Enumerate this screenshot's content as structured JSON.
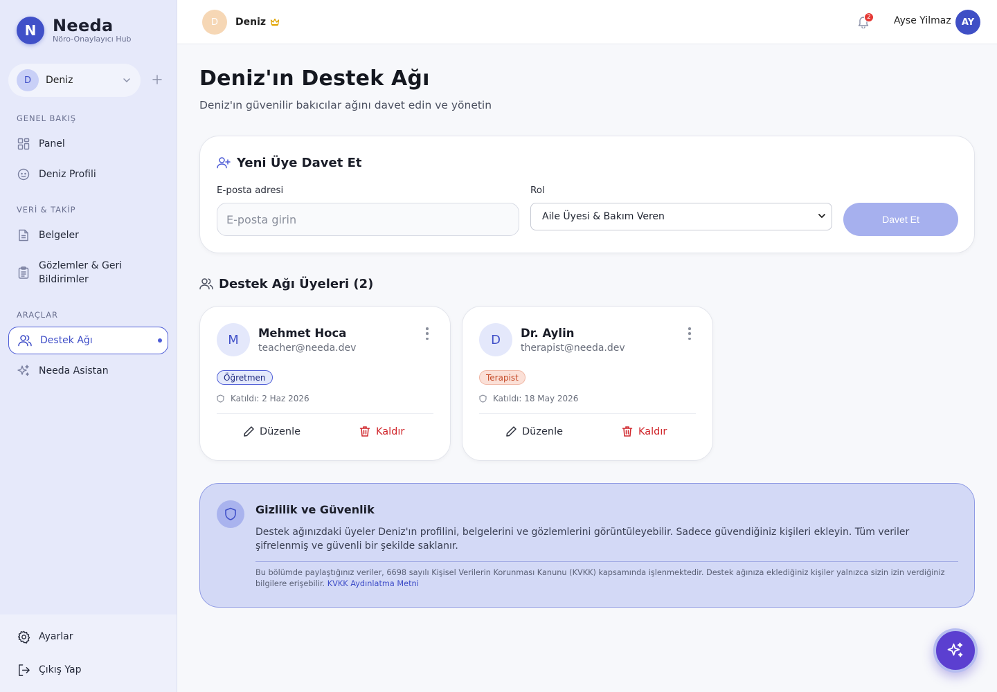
{
  "brand": {
    "logo_letter": "N",
    "name": "Needa",
    "subtitle": "Nöro-Onaylayıcı Hub"
  },
  "child_selector": {
    "avatar_letter": "D",
    "name": "Deniz"
  },
  "sidebar": {
    "sections": [
      {
        "label": "GENEL BAKIŞ",
        "items": [
          {
            "label": "Panel",
            "icon": "grid-icon"
          },
          {
            "label": "Deniz Profili",
            "icon": "face-icon"
          }
        ]
      },
      {
        "label": "VERİ & TAKİP",
        "items": [
          {
            "label": "Belgeler",
            "icon": "document-icon"
          },
          {
            "label": "Gözlemler & Geri Bildirimler",
            "icon": "clipboard-icon"
          }
        ]
      },
      {
        "label": "ARAÇLAR",
        "items": [
          {
            "label": "Destek Ağı",
            "icon": "users-icon",
            "active": true
          },
          {
            "label": "Needa Asistan",
            "icon": "sparkle-icon"
          }
        ]
      }
    ],
    "bottom": [
      {
        "label": "Ayarlar",
        "icon": "gear-icon"
      },
      {
        "label": "Çıkış Yap",
        "icon": "logout-icon"
      }
    ]
  },
  "topbar": {
    "child_avatar_letter": "D",
    "child_name": "Deniz",
    "notification_count": "2",
    "user_name": "Ayse Yilmaz",
    "user_initials": "AY"
  },
  "page": {
    "title": "Deniz'ın Destek Ağı",
    "subtitle": "Deniz'ın güvenilir bakıcılar ağını davet edin ve yönetin"
  },
  "invite": {
    "title": "Yeni Üye Davet Et",
    "email_label": "E-posta adresi",
    "email_placeholder": "E-posta girin",
    "role_label": "Rol",
    "role_selected": "Aile Üyesi & Bakım Veren",
    "button": "Davet Et"
  },
  "members": {
    "title": "Destek Ağı Üyeleri (2)",
    "edit_label": "Düzenle",
    "remove_label": "Kaldır",
    "list": [
      {
        "initial": "M",
        "name": "Mehmet Hoca",
        "email": "teacher@needa.dev",
        "role": "Öğretmen",
        "joined": "Katıldı: 2 Haz 2026"
      },
      {
        "initial": "D",
        "name": "Dr. Aylin",
        "email": "therapist@needa.dev",
        "role": "Terapist",
        "joined": "Katıldı: 18 May 2026"
      }
    ]
  },
  "privacy": {
    "title": "Gizlilik ve Güvenlik",
    "text": "Destek ağınızdaki üyeler Deniz'ın profilini, belgelerini ve gözlemlerini görüntüleyebilir. Sadece güvendiğiniz kişileri ekleyin. Tüm veriler şifrelenmiş ve güvenli bir şekilde saklanır.",
    "legal": "Bu bölümde paylaştığınız veriler, 6698 sayılı Kişisel Verilerin Korunması Kanunu (KVKK) kapsamında işlenmektedir. Destek ağınıza eklediğiniz kişiler yalnızca sizin izin verdiğiniz bilgilere erişebilir.",
    "link": "KVKK Aydınlatma Metni"
  },
  "colors": {
    "accent": "#4d5cd6",
    "danger": "#d0262b",
    "sidebar_bg": "#e6e9fa",
    "privacy_bg": "#d3d9f6"
  }
}
